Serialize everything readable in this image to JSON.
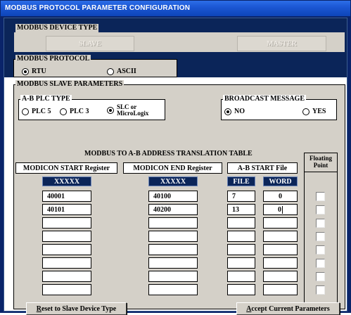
{
  "window": {
    "title": "MODBUS PROTOCOL PARAMETER CONFIGURATION"
  },
  "device_type": {
    "label": "MODBUS DEVICE TYPE",
    "slave_label": "SLAVE",
    "master_label": "MASTER"
  },
  "protocol": {
    "label": "MODBUS PROTOCOL",
    "options": [
      {
        "label": "RTU",
        "selected": true
      },
      {
        "label": "ASCII",
        "selected": false
      }
    ]
  },
  "slave_params": {
    "label": "MODBUS SLAVE PARAMETERS",
    "plc_type": {
      "label": "A-B PLC TYPE",
      "options": [
        {
          "label": "PLC 5",
          "selected": false
        },
        {
          "label": "PLC 3",
          "selected": false
        },
        {
          "label_line1": "SLC or",
          "label_line2": "MicroLogix",
          "selected": true
        }
      ]
    },
    "broadcast": {
      "label": "BROADCAST MESSAGE",
      "options": [
        {
          "label": "NO",
          "selected": true
        },
        {
          "label": "YES",
          "selected": false
        }
      ]
    }
  },
  "translation_table": {
    "title": "MODBUS TO A-B ADDRESS TRANSLATION TABLE",
    "headers": {
      "start": "MODICON START Register",
      "end": "MODICON END Register",
      "ab_start": "A-B START File",
      "floating": "Floating Point"
    },
    "placeholders": {
      "start": "XXXXX",
      "end": "XXXXX",
      "file": "FILE",
      "word": "WORD"
    },
    "rows": [
      {
        "start": "40001",
        "end": "40100",
        "file": "7",
        "word": "0",
        "floating": false
      },
      {
        "start": "40101",
        "end": "40200",
        "file": "13",
        "word": "0",
        "floating": false
      },
      {
        "start": "",
        "end": "",
        "file": "",
        "word": "",
        "floating": false
      },
      {
        "start": "",
        "end": "",
        "file": "",
        "word": "",
        "floating": false
      },
      {
        "start": "",
        "end": "",
        "file": "",
        "word": "",
        "floating": false
      },
      {
        "start": "",
        "end": "",
        "file": "",
        "word": "",
        "floating": false
      },
      {
        "start": "",
        "end": "",
        "file": "",
        "word": "",
        "floating": false
      },
      {
        "start": "",
        "end": "",
        "file": "",
        "word": "",
        "floating": false
      }
    ]
  },
  "buttons": {
    "reset_underlined": "R",
    "reset_rest": "eset to Slave Device Type",
    "accept_underlined": "A",
    "accept_rest": "ccept Current Parameters"
  },
  "colors": {
    "panel_navy": "#0b2559",
    "title_blue": "#1c57d4",
    "dialog_gray": "#d4d0c8"
  }
}
